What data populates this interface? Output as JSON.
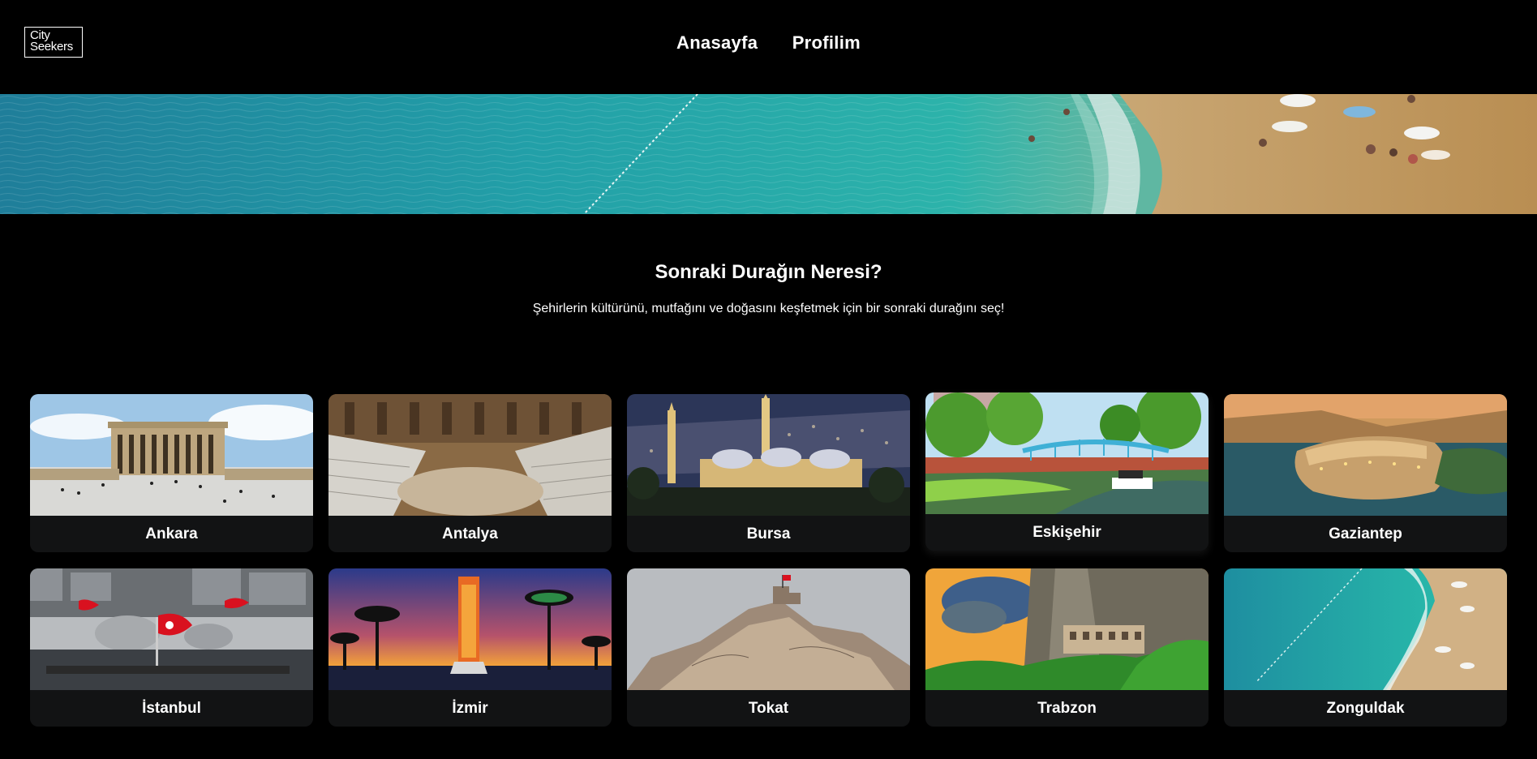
{
  "header": {
    "logo_line1": "City",
    "logo_line2": "Seekers",
    "nav": [
      "Anasayfa",
      "Profilim"
    ]
  },
  "hero": {
    "title": "Sonraki Durağın Neresi?",
    "subtitle": "Şehirlerin kültürünü, mutfağını ve doğasını keşfetmek için bir sonraki durağını seç!"
  },
  "cities": [
    {
      "name": "Ankara"
    },
    {
      "name": "Antalya"
    },
    {
      "name": "Bursa"
    },
    {
      "name": "Eskişehir"
    },
    {
      "name": "Gaziantep"
    },
    {
      "name": "İstanbul"
    },
    {
      "name": "İzmir"
    },
    {
      "name": "Tokat"
    },
    {
      "name": "Trabzon"
    },
    {
      "name": "Zonguldak"
    }
  ],
  "colors": {
    "background": "#000000",
    "card_background": "#121314",
    "text": "#ffffff"
  }
}
